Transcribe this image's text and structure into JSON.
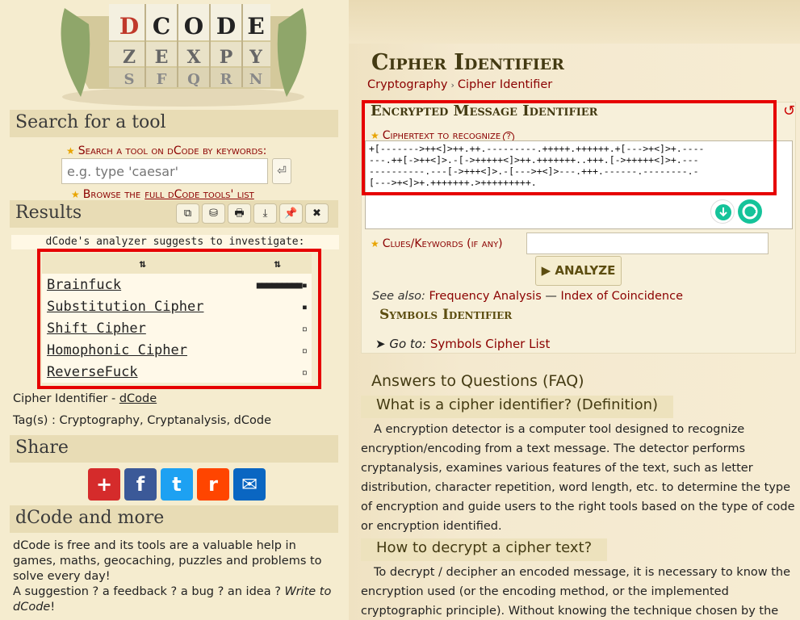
{
  "logo": {
    "letters": [
      [
        "C",
        "D",
        "O",
        "D",
        "E"
      ],
      [
        "Z",
        "E",
        "X",
        "P",
        "Y"
      ],
      [
        "S",
        "F",
        "Q",
        "R",
        "N"
      ]
    ]
  },
  "sidebar": {
    "search_title": "Search for a tool",
    "search_label": "Search a tool on dCode by keywords:",
    "search_placeholder": "e.g. type 'caesar'",
    "search_go": "⏎",
    "browse_prefix": "Browse the",
    "browse_link": "full dCode tools' list",
    "results_title": "Results",
    "result_tools": [
      "⧉",
      "⛁",
      "🖶",
      "⤓",
      "📌",
      "✖"
    ],
    "analyzer_note": "dCode's analyzer suggests to investigate:",
    "table_headers": [
      "⇅",
      "⇅"
    ],
    "results": [
      {
        "name": "Brainfuck",
        "score": "■■■■■■■■■▪"
      },
      {
        "name": "Substitution Cipher",
        "score": "▪"
      },
      {
        "name": "Shift Cipher",
        "score": "▫"
      },
      {
        "name": "Homophonic Cipher",
        "score": "▫"
      },
      {
        "name": "ReverseFuck",
        "score": "▫"
      }
    ],
    "cipher_id_text": "Cipher Identifier - ",
    "cipher_id_link": "dCode",
    "tags_text": "Tag(s) : Cryptography, Cryptanalysis, dCode",
    "share_title": "Share",
    "share_buttons": [
      "+",
      "f",
      "t",
      "r",
      "✉"
    ],
    "more_title": "dCode and more",
    "more_text_1": "dCode is free and its tools are a valuable help in games, maths, geocaching, puzzles and problems to solve every day!",
    "more_text_2": "A suggestion ? a feedback ? a bug ? an idea ? ",
    "more_text_link": "Write to dCode",
    "more_text_end": "!"
  },
  "main": {
    "page_title": "Cipher Identifier",
    "breadcrumb": [
      "Cryptography",
      "Cipher Identifier"
    ],
    "breadcrumb_sep": "›",
    "tool_title": "Encrypted Message Identifier",
    "reset_icon": "↺",
    "ciphertext_label": "Ciphertext to recognize",
    "help": "?",
    "ciphertext": "+[------->++<]>++.++.---------.+++++.++++++.+[--->+<]>+.----.++[->++<]>.-[->+++++<]>++.+++++++..+++.[->+++++<]>+.-------------.---[->+++<]>.-[--->+<]>---.+++.------.--------.-[--->+<]>+.+++++++.>+++++++++.",
    "ciphertext_lines": [
      "+[------->++<]>++.++.---------.+++++.++++++.+[--->+<]>+.----",
      "---.++[->++<]>.-[->+++++<]>++.+++++++..+++.[->+++++<]>+.---",
      "----------.---[->+++<]>.-[--->+<]>---.+++.------.--------.-",
      "[--->+<]>+.+++++++.>+++++++++."
    ],
    "clues_label": "Clues/Keywords (if any)",
    "analyze_label": "▶ ANALYZE",
    "see_also_label": "See also:",
    "see_also_1": "Frequency Analysis",
    "see_also_sep": " — ",
    "see_also_2": "Index of Coincidence",
    "symbols_identifier": "Symbols Identifier",
    "goto_label": "Go to:",
    "goto_link": "Symbols Cipher List",
    "faq_title": "Answers to Questions (FAQ)",
    "faq": [
      {
        "q": "What is a cipher identifier? (Definition)",
        "a": "A encryption detector is a computer tool designed to recognize encryption/encoding from a text message. The detector performs cryptanalysis, examines various features of the text, such as letter distribution, character repetition, word length, etc. to determine the type of encryption and guide users to the right tools based on the type of code or encryption identified."
      },
      {
        "q": "How to decrypt a cipher text?",
        "a": "To decrypt / decipher an encoded message, it is necessary to know the encryption used (or the encoding method, or the implemented cryptographic principle). Without knowing the technique chosen by the"
      }
    ]
  },
  "colors": {
    "accent_red": "#8b0000",
    "highlight_box": "#e60000",
    "sidebar_bg": "#f5eccf",
    "header_bg": "#e8dcb5"
  }
}
